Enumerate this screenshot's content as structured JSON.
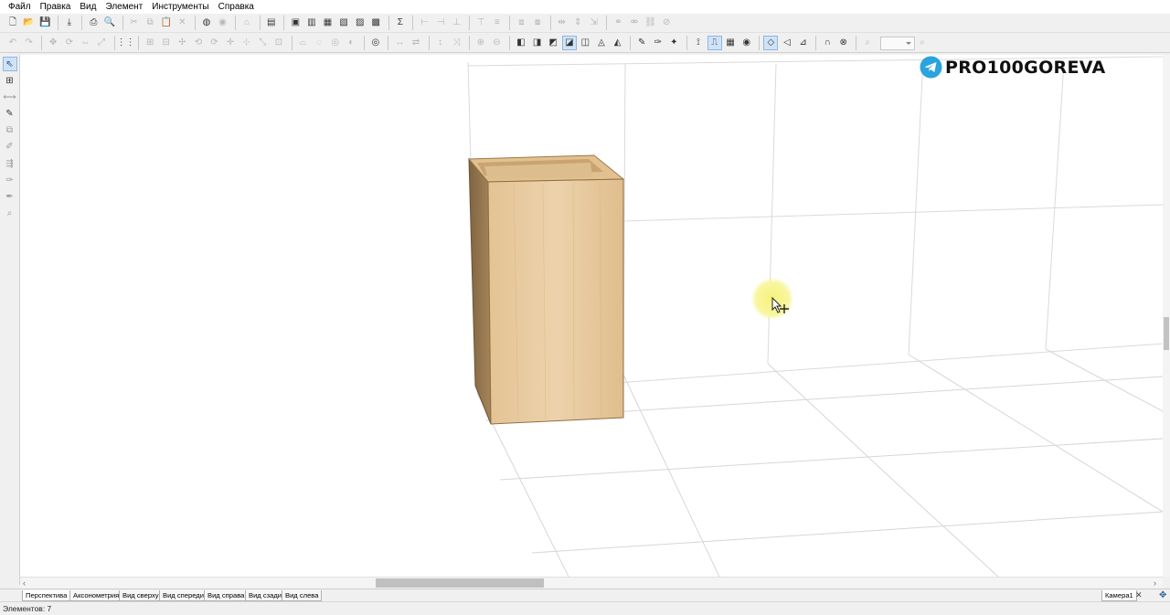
{
  "menu": {
    "items": [
      "Файл",
      "Правка",
      "Вид",
      "Элемент",
      "Инструменты",
      "Справка"
    ]
  },
  "toolbar1": {
    "buttons": [
      {
        "name": "new-file-icon",
        "glyph": "🗋",
        "enabled": true
      },
      {
        "name": "open-file-icon",
        "glyph": "📂",
        "enabled": true
      },
      {
        "name": "save-icon",
        "glyph": "💾",
        "enabled": true
      },
      {
        "sep": true
      },
      {
        "name": "export-icon",
        "glyph": "⤓",
        "enabled": true
      },
      {
        "sep": true
      },
      {
        "name": "print-icon",
        "glyph": "⎙",
        "enabled": true
      },
      {
        "name": "print-preview-icon",
        "glyph": "🔍",
        "enabled": true
      },
      {
        "sep": true
      },
      {
        "name": "cut-icon",
        "glyph": "✂",
        "enabled": false
      },
      {
        "name": "copy-icon",
        "glyph": "⧉",
        "enabled": false
      },
      {
        "name": "paste-icon",
        "glyph": "📋",
        "enabled": false
      },
      {
        "name": "delete-icon",
        "glyph": "✕",
        "enabled": false
      },
      {
        "sep": true
      },
      {
        "name": "globe-icon",
        "glyph": "◍",
        "enabled": true
      },
      {
        "name": "disc-icon",
        "glyph": "◉",
        "enabled": false
      },
      {
        "sep": true
      },
      {
        "name": "library-icon",
        "glyph": "⌂",
        "enabled": false
      },
      {
        "sep": true
      },
      {
        "name": "panel-icon",
        "glyph": "▤",
        "enabled": true
      },
      {
        "sep": true
      },
      {
        "name": "sheet-icon",
        "glyph": "▣",
        "enabled": true
      },
      {
        "name": "sheet-cut-icon",
        "glyph": "▥",
        "enabled": true
      },
      {
        "name": "edge-icon",
        "glyph": "▦",
        "enabled": true
      },
      {
        "name": "box-icon",
        "glyph": "▧",
        "enabled": true
      },
      {
        "name": "report-icon",
        "glyph": "▨",
        "enabled": true
      },
      {
        "name": "shelf-icon",
        "glyph": "▩",
        "enabled": true
      },
      {
        "sep": true
      },
      {
        "name": "sum-icon",
        "glyph": "Σ",
        "enabled": true
      },
      {
        "sep": true
      },
      {
        "name": "align-left-icon",
        "glyph": "⊢",
        "enabled": false
      },
      {
        "name": "align-center-icon",
        "glyph": "⊣",
        "enabled": false
      },
      {
        "name": "align-right-icon",
        "glyph": "⊥",
        "enabled": false
      },
      {
        "sep": true
      },
      {
        "name": "align-top-icon",
        "glyph": "⊤",
        "enabled": false
      },
      {
        "name": "align-middle-icon",
        "glyph": "≡",
        "enabled": false
      },
      {
        "sep": true
      },
      {
        "name": "group-icon",
        "glyph": "⧈",
        "enabled": false
      },
      {
        "name": "ungroup-icon",
        "glyph": "⧇",
        "enabled": false
      },
      {
        "sep": true
      },
      {
        "name": "distribute-h-icon",
        "glyph": "⇹",
        "enabled": false
      },
      {
        "name": "distribute-v-icon",
        "glyph": "⇕",
        "enabled": false
      },
      {
        "name": "size-icon",
        "glyph": "⇲",
        "enabled": false
      },
      {
        "sep": true
      },
      {
        "name": "link-icon",
        "glyph": "⚭",
        "enabled": false
      },
      {
        "name": "unlink-icon",
        "glyph": "⚮",
        "enabled": false
      },
      {
        "name": "chain-icon",
        "glyph": "⛓",
        "enabled": false
      },
      {
        "name": "lock-icon",
        "glyph": "⊘",
        "enabled": false
      }
    ]
  },
  "toolbar2": {
    "buttons": [
      {
        "name": "undo-icon",
        "glyph": "↶",
        "enabled": false
      },
      {
        "name": "redo-icon",
        "glyph": "↷",
        "enabled": false
      },
      {
        "sep": true
      },
      {
        "name": "move-icon",
        "glyph": "✥",
        "enabled": false
      },
      {
        "name": "rotate-icon",
        "glyph": "⟳",
        "enabled": false
      },
      {
        "name": "mirror-icon",
        "glyph": "⇔",
        "enabled": false
      },
      {
        "name": "scale-icon",
        "glyph": "⤢",
        "enabled": false
      },
      {
        "sep": true
      },
      {
        "name": "grid-icon",
        "glyph": "⋮⋮",
        "enabled": true
      },
      {
        "sep": true
      },
      {
        "name": "snap-icon",
        "glyph": "⊞",
        "enabled": false
      },
      {
        "name": "snap-face-icon",
        "glyph": "⊟",
        "enabled": false
      },
      {
        "name": "pivot-icon",
        "glyph": "✢",
        "enabled": false
      },
      {
        "name": "rotate-y-icon",
        "glyph": "⟲",
        "enabled": false
      },
      {
        "name": "rotate-x-icon",
        "glyph": "⟳",
        "enabled": false
      },
      {
        "name": "move-axis-icon",
        "glyph": "✛",
        "enabled": false
      },
      {
        "name": "offset-icon",
        "glyph": "⊹",
        "enabled": false
      },
      {
        "name": "stretch-icon",
        "glyph": "⤡",
        "enabled": false
      },
      {
        "name": "arrange-icon",
        "glyph": "⊡",
        "enabled": false
      },
      {
        "sep": true
      },
      {
        "name": "cut-shape-icon",
        "glyph": "⌓",
        "enabled": false
      },
      {
        "name": "drill-icon",
        "glyph": "◌",
        "enabled": false
      },
      {
        "name": "edge-band-icon",
        "glyph": "◎",
        "enabled": false
      },
      {
        "name": "visibility-icon",
        "glyph": "◐",
        "enabled": false
      },
      {
        "sep": true
      },
      {
        "name": "target-icon",
        "glyph": "◎",
        "enabled": true
      },
      {
        "sep": true
      },
      {
        "name": "dim-h-icon",
        "glyph": "↔",
        "enabled": false
      },
      {
        "name": "dim-o-icon",
        "glyph": "⇄",
        "enabled": false
      },
      {
        "sep": true
      },
      {
        "name": "dim-v-icon",
        "glyph": "↕",
        "enabled": false
      },
      {
        "name": "dim-d-icon",
        "glyph": "⤨",
        "enabled": false
      },
      {
        "sep": true
      },
      {
        "name": "step-icon",
        "glyph": "⊕",
        "enabled": false
      },
      {
        "name": "step2-icon",
        "glyph": "⊖",
        "enabled": false
      },
      {
        "sep": true
      },
      {
        "name": "view-box-icon",
        "glyph": "◧",
        "enabled": true
      },
      {
        "name": "view-wire-icon",
        "glyph": "◨",
        "enabled": true
      },
      {
        "name": "view-shaded-icon",
        "glyph": "◩",
        "enabled": true
      },
      {
        "name": "view-textured-icon",
        "glyph": "◪",
        "enabled": true,
        "active": true
      },
      {
        "name": "view-front-icon",
        "glyph": "◫",
        "enabled": true
      },
      {
        "name": "view-side-icon",
        "glyph": "◬",
        "enabled": true
      },
      {
        "name": "view-top-icon",
        "glyph": "◭",
        "enabled": true
      },
      {
        "sep": true
      },
      {
        "name": "material-icon",
        "glyph": "✎",
        "enabled": true
      },
      {
        "name": "paint-icon",
        "glyph": "✑",
        "enabled": true
      },
      {
        "name": "light-icon",
        "glyph": "✦",
        "enabled": true
      },
      {
        "sep": true
      },
      {
        "name": "measure-icon",
        "glyph": "⟟",
        "enabled": true
      },
      {
        "name": "ruler-icon",
        "glyph": "⎍",
        "enabled": true,
        "active": true
      },
      {
        "name": "raster-icon",
        "glyph": "▦",
        "enabled": true
      },
      {
        "name": "eye-icon",
        "glyph": "◉",
        "enabled": true
      },
      {
        "sep": true
      },
      {
        "name": "snap-point-icon",
        "glyph": "◇",
        "enabled": true,
        "active": true
      },
      {
        "name": "snap-corner-icon",
        "glyph": "◁",
        "enabled": true
      },
      {
        "name": "snap-edge-icon",
        "glyph": "⊿",
        "enabled": true
      },
      {
        "sep": true
      },
      {
        "name": "magnet-icon",
        "glyph": "∩",
        "enabled": true
      },
      {
        "name": "stop-icon",
        "glyph": "⊗",
        "enabled": true
      },
      {
        "sep": true
      },
      {
        "name": "zoom-icon",
        "glyph": "⌕",
        "enabled": false
      }
    ],
    "zoom_value": ""
  },
  "left_tools": [
    {
      "name": "select-tool-icon",
      "glyph": "⇖",
      "state": "active"
    },
    {
      "name": "grid-snap-tool-icon",
      "glyph": "⊞",
      "state": "enabled"
    },
    {
      "name": "measure-tool-icon",
      "glyph": "⟷",
      "state": "disabled"
    },
    {
      "name": "pipette-tool-icon",
      "glyph": "✎",
      "state": "enabled"
    },
    {
      "name": "copy-tool-icon",
      "glyph": "⧉",
      "state": "disabled"
    },
    {
      "name": "edit-tool-icon",
      "glyph": "✐",
      "state": "disabled"
    },
    {
      "name": "spread-tool-icon",
      "glyph": "⇶",
      "state": "disabled"
    },
    {
      "name": "cursor-tool-icon",
      "glyph": "✑",
      "state": "disabled"
    },
    {
      "name": "tool-9-icon",
      "glyph": "✒",
      "state": "disabled"
    },
    {
      "name": "zoom-tool-icon",
      "glyph": "⌕",
      "state": "disabled"
    }
  ],
  "watermark": {
    "text": "PRO100GOREVA",
    "colors": {
      "circle": "#2aa3de",
      "plane": "#ffffff"
    }
  },
  "scene": {
    "colors": {
      "wood_front": "#e7c79b",
      "wood_side": "#9a7b4f",
      "wood_top": "#d8b787",
      "wood_edge": "#b28a58",
      "grid_line": "#d6d6d6"
    }
  },
  "view_tabs": [
    {
      "label": "Перспектива",
      "selected": true
    },
    {
      "label": "Аксонометрия",
      "selected": false
    },
    {
      "label": "Вид сверху",
      "selected": false
    },
    {
      "label": "Вид спереди",
      "selected": false
    },
    {
      "label": "Вид справа",
      "selected": false
    },
    {
      "label": "Вид сзади",
      "selected": false
    },
    {
      "label": "Вид слева",
      "selected": false
    }
  ],
  "camera": {
    "tab_label": "Камера1",
    "close_glyph": "✕",
    "add_glyph": "✥"
  },
  "scroll": {
    "left_arrow": "‹",
    "right_arrow": "›"
  },
  "status": {
    "elements": "Элементов: 7"
  }
}
